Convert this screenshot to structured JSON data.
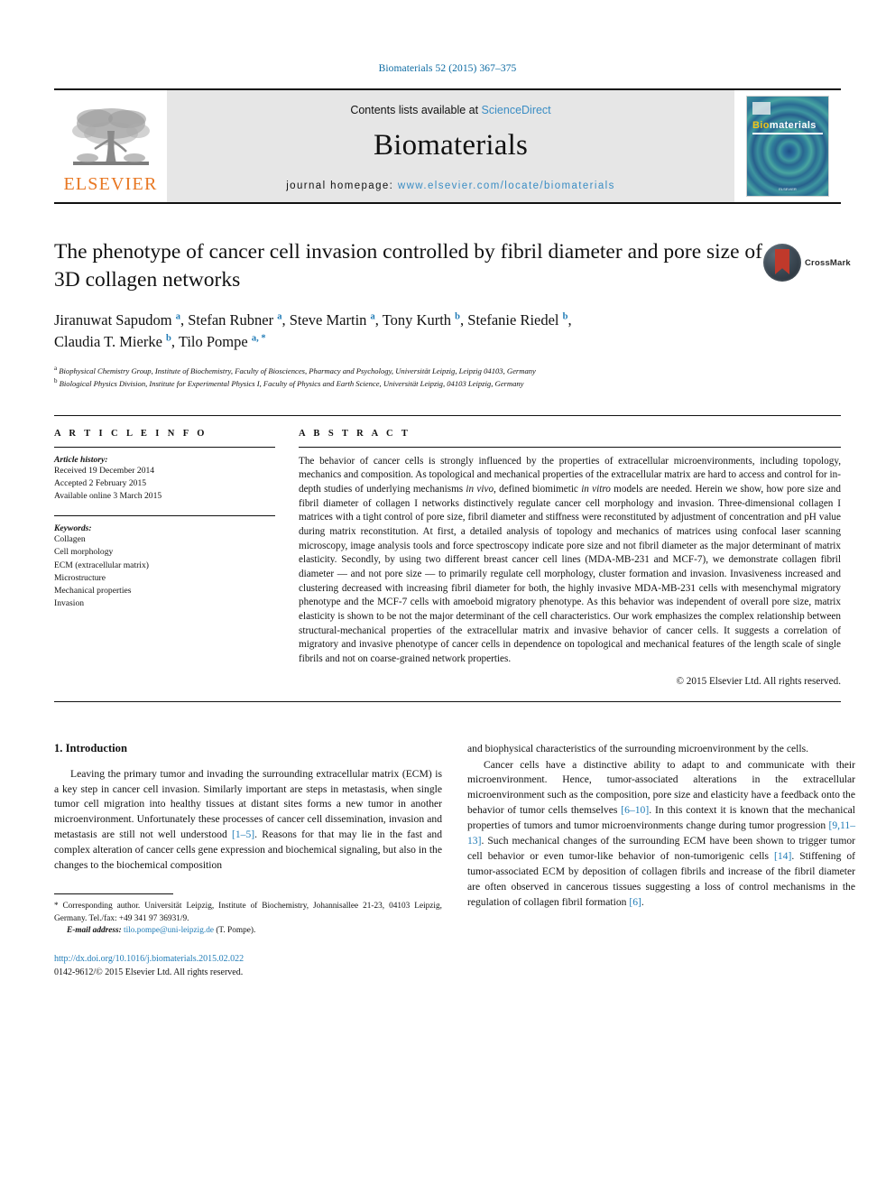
{
  "running_head": "Biomaterials 52 (2015) 367–375",
  "masthead": {
    "publisher_name": "ELSEVIER",
    "contents_prefix": "Contents lists available at ",
    "contents_link": "ScienceDirect",
    "journal_name": "Biomaterials",
    "homepage_prefix": "journal homepage: ",
    "homepage_url": "www.elsevier.com/locate/biomaterials",
    "cover_title_part1": "Bio",
    "cover_title_part2": "materials",
    "cover_footer": "ELSEVIER"
  },
  "colors": {
    "link_blue": "#3a8dc4",
    "ref_blue": "#1f7bb6",
    "elsevier_orange": "#e87722",
    "masthead_grey": "#e6e6e6",
    "crossmark_red": "#c0392b"
  },
  "article": {
    "title": "The phenotype of cancer cell invasion controlled by fibril diameter and pore size of 3D collagen networks",
    "crossmark_label": "CrossMark",
    "authors_line1_parts": [
      {
        "name": "Jiranuwat Sapudom ",
        "sup": "a"
      },
      {
        "name": ", Stefan Rubner ",
        "sup": "a"
      },
      {
        "name": ", Steve Martin ",
        "sup": "a"
      },
      {
        "name": ", Tony Kurth ",
        "sup": "b"
      },
      {
        "name": ", Stefanie Riedel ",
        "sup": "b"
      }
    ],
    "authors_line2_parts": [
      {
        "name": "Claudia T. Mierke ",
        "sup": "b"
      },
      {
        "name": ", Tilo Pompe ",
        "sup": "a, *"
      }
    ],
    "affiliation_a_marker": "a",
    "affiliation_a": "Biophysical Chemistry Group, Institute of Biochemistry, Faculty of Biosciences, Pharmacy and Psychology, Universität Leipzig, Leipzig 04103, Germany",
    "affiliation_b_marker": "b",
    "affiliation_b": "Biological Physics Division, Institute for Experimental Physics I, Faculty of Physics and Earth Science, Universität Leipzig, 04103 Leipzig, Germany"
  },
  "article_info": {
    "heading": "A R T I C L E  I N F O",
    "history_label": "Article history:",
    "history": [
      "Received 19 December 2014",
      "Accepted 2 February 2015",
      "Available online 3 March 2015"
    ],
    "keywords_label": "Keywords:",
    "keywords": [
      "Collagen",
      "Cell morphology",
      "ECM (extracellular matrix)",
      "Microstructure",
      "Mechanical properties",
      "Invasion"
    ]
  },
  "abstract": {
    "heading": "A B S T R A C T",
    "part1": "The behavior of cancer cells is strongly influenced by the properties of extracellular microenvironments, including topology, mechanics and composition. As topological and mechanical properties of the extracellular matrix are hard to access and control for in-depth studies of underlying mechanisms ",
    "invivo": "in vivo",
    "part2": ", defined biomimetic ",
    "invitro": "in vitro",
    "part3": " models are needed. Herein we show, how pore size and fibril diameter of collagen I networks distinctively regulate cancer cell morphology and invasion. Three-dimensional collagen I matrices with a tight control of pore size, fibril diameter and stiffness were reconstituted by adjustment of concentration and pH value during matrix reconstitution. At first, a detailed analysis of topology and mechanics of matrices using confocal laser scanning microscopy, image analysis tools and force spectroscopy indicate pore size and not fibril diameter as the major determinant of matrix elasticity. Secondly, by using two different breast cancer cell lines (MDA-MB-231 and MCF-7), we demonstrate collagen fibril diameter — and not pore size — to primarily regulate cell morphology, cluster formation and invasion. Invasiveness increased and clustering decreased with increasing fibril diameter for both, the highly invasive MDA-MB-231 cells with mesenchymal migratory phenotype and the MCF-7 cells with amoeboid migratory phenotype. As this behavior was independent of overall pore size, matrix elasticity is shown to be not the major determinant of the cell characteristics. Our work emphasizes the complex relationship between structural-mechanical properties of the extracellular matrix and invasive behavior of cancer cells. It suggests a correlation of migratory and invasive phenotype of cancer cells in dependence on topological and mechanical features of the length scale of single fibrils and not on coarse-grained network properties.",
    "copyright": "© 2015 Elsevier Ltd. All rights reserved."
  },
  "introduction": {
    "section_number_title": "1. Introduction",
    "left_p1_a": "Leaving the primary tumor and invading the surrounding extracellular matrix (ECM) is a key step in cancer cell invasion. Similarly important are steps in metastasis, when single tumor cell migration into healthy tissues at distant sites forms a new tumor in another microenvironment. Unfortunately these processes of cancer cell dissemination, invasion and metastasis are still not well understood ",
    "left_ref1": "[1–5]",
    "left_p1_b": ". Reasons for that may lie in the fast and complex alteration of cancer cells gene expression and biochemical signaling, but also in the changes to the biochemical composition",
    "right_p1_cont": "and biophysical characteristics of the surrounding microenvironment by the cells.",
    "right_p2_a": "Cancer cells have a distinctive ability to adapt to and communicate with their microenvironment. Hence, tumor-associated alterations in the extracellular microenvironment such as the composition, pore size and elasticity have a feedback onto the behavior of tumor cells themselves ",
    "right_ref1": "[6–10]",
    "right_p2_b": ". In this context it is known that the mechanical properties of tumors and tumor microenvironments change during tumor progression ",
    "right_ref2": "[9,11–13]",
    "right_p2_c": ". Such mechanical changes of the surrounding ECM have been shown to trigger tumor cell behavior or even tumor-like behavior of non-tumorigenic cells ",
    "right_ref3": "[14]",
    "right_p2_d": ". Stiffening of tumor-associated ECM by deposition of collagen fibrils and increase of the fibril diameter are often observed in cancerous tissues suggesting a loss of control mechanisms in the regulation of collagen fibril formation ",
    "right_ref4": "[6]",
    "right_p2_e": "."
  },
  "footer": {
    "corresponding_star": "*",
    "corresponding_text": " Corresponding author. Universität Leipzig, Institute of Biochemistry, Johannisallee 21-23, 04103 Leipzig, Germany. Tel./fax: +49 341 97 36931/9.",
    "email_label": "E-mail address:",
    "email": "tilo.pompe@uni-leipzig.de",
    "email_suffix": " (T. Pompe).",
    "doi": "http://dx.doi.org/10.1016/j.biomaterials.2015.02.022",
    "issn_line": "0142-9612/© 2015 Elsevier Ltd. All rights reserved."
  }
}
